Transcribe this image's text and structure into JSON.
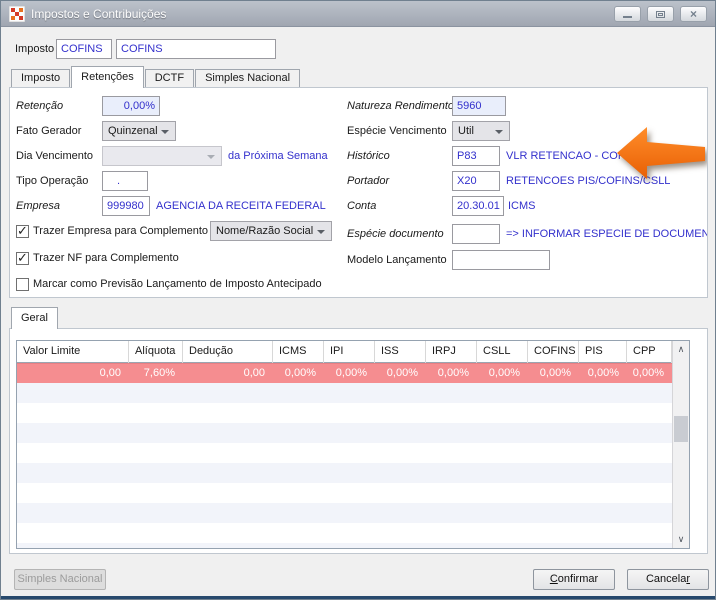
{
  "window": {
    "title": "Impostos e Contribuições"
  },
  "icons": {
    "close": "×",
    "scroll_up": "∧",
    "scroll_down": "∨",
    "check": "✓"
  },
  "header": {
    "label": "Imposto",
    "code": "COFINS",
    "name": "COFINS"
  },
  "tabs": {
    "items": [
      {
        "label": "Imposto"
      },
      {
        "label": "Retenções"
      },
      {
        "label": "DCTF"
      },
      {
        "label": "Simples Nacional"
      }
    ]
  },
  "form": {
    "left": {
      "retencao": {
        "label": "Retenção",
        "value": "0,00%"
      },
      "fato_gerador": {
        "label": "Fato Gerador",
        "value": "Quinzenal"
      },
      "dia_vencimento": {
        "label": "Dia Vencimento",
        "value": "",
        "suffix": "da Próxima Semana"
      },
      "tipo_operacao": {
        "label": "Tipo Operação",
        "value": "."
      },
      "empresa": {
        "label": "Empresa",
        "value": "999980",
        "description": "AGENCIA DA RECEITA FEDERAL"
      },
      "checkboxes": [
        {
          "label": "Trazer Empresa para Complemento",
          "mark": "✓",
          "combo": "Nome/Razão Social"
        },
        {
          "label": "Trazer NF para Complemento",
          "mark": "✓"
        },
        {
          "label": "Marcar como Previsão Lançamento de Imposto Antecipado",
          "mark": ""
        }
      ]
    },
    "right": {
      "natureza_rendimento": {
        "label": "Natureza Rendimento",
        "value": "5960"
      },
      "especie_vencimento": {
        "label": "Espécie Vencimento",
        "value": "Util"
      },
      "historico": {
        "label": "Histórico",
        "value": "P83",
        "description": "VLR RETENCAO - COFINS"
      },
      "portador": {
        "label": "Portador",
        "value": "X20",
        "description": "RETENCOES PIS/COFINS/CSLL"
      },
      "conta": {
        "label": "Conta",
        "value": "20.30.01",
        "description": "ICMS"
      },
      "especie_documento": {
        "label": "Espécie documento",
        "value": "",
        "description": "=> INFORMAR ESPECIE DE DOCUMENTO"
      },
      "modelo_lancamento": {
        "label": "Modelo Lançamento",
        "value": ""
      }
    }
  },
  "geral_tab": {
    "label": "Geral"
  },
  "table": {
    "columns": [
      "Valor Limite",
      "Alíquota",
      "Dedução",
      "ICMS",
      "IPI",
      "ISS",
      "IRPJ",
      "CSLL",
      "COFINS",
      "PIS",
      "CPP"
    ],
    "rows": [
      [
        "0,00",
        "7,60%",
        "0,00",
        "0,00%",
        "0,00%",
        "0,00%",
        "0,00%",
        "0,00%",
        "0,00%",
        "0,00%",
        "0,00%"
      ]
    ],
    "empty_row_count": 9
  },
  "footer": {
    "simples_nacional": "Simples Nacional",
    "confirmar": {
      "pre": "",
      "key": "C",
      "post": "onfirmar"
    },
    "cancelar": {
      "pre": "Cancela",
      "key": "r",
      "post": ""
    }
  },
  "colors": {
    "accent_blue": "#3330cc",
    "row_highlight": "#f58d90",
    "arrow_orange": "#f26b0a",
    "field_highlight_bg": "#e9eefb"
  }
}
